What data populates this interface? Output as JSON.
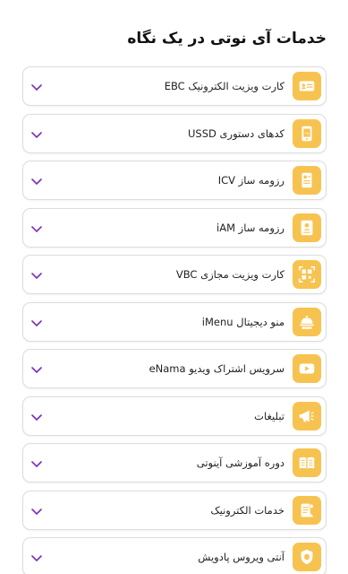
{
  "page": {
    "title": "خدمات آی نوتی در یک نگاه"
  },
  "colors": {
    "accent": "#f7c350",
    "chevron": "#7b2cbf"
  },
  "services": [
    {
      "label": "کارت ویزیت الکترونیک EBC",
      "icon": "business-card-icon"
    },
    {
      "label": "کدهای دستوری USSD",
      "icon": "phone-code-icon"
    },
    {
      "label": "رزومه ساز ICV",
      "icon": "resume-document-icon"
    },
    {
      "label": "رزومه ساز iAM",
      "icon": "profile-card-icon"
    },
    {
      "label": "کارت ویزیت مجازی VBC",
      "icon": "qr-code-icon"
    },
    {
      "label": "منو دیجیتال iMenu",
      "icon": "food-cloche-icon"
    },
    {
      "label": "سرویس اشتراک ویدیو eNama",
      "icon": "video-play-icon"
    },
    {
      "label": "تبلیغات",
      "icon": "megaphone-icon"
    },
    {
      "label": "دوره آموزشی آینوتی",
      "icon": "open-book-icon"
    },
    {
      "label": "خدمات الکترونیک",
      "icon": "e-document-icon"
    },
    {
      "label": "آنتی ویروس پادویش",
      "icon": "shield-icon"
    }
  ]
}
